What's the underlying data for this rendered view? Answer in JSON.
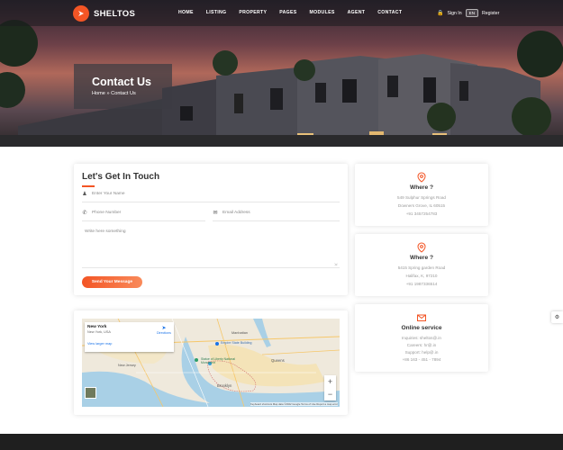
{
  "brand": {
    "name": "SHELTOS",
    "accent": "#f35525"
  },
  "nav": {
    "items": [
      "HOME",
      "LISTING",
      "PROPERTY",
      "PAGES",
      "MODULES",
      "AGENT",
      "CONTACT"
    ],
    "signin": "Sign In",
    "lang": "EN",
    "register": "Register"
  },
  "hero": {
    "title": "Contact Us",
    "crumb_home": "Home",
    "crumb_sep": "»",
    "crumb_current": "Contact Us"
  },
  "form": {
    "title": "Let's Get In Touch",
    "name_placeholder": "Enter Your Name",
    "phone_placeholder": "Phone Number",
    "email_placeholder": "Email Address",
    "message_placeholder": "Write here something",
    "send_label": "Send Your Message"
  },
  "info": [
    {
      "heading": "Where ?",
      "lines": [
        "549 Sulphur Springs Road",
        "Downers Grove, IL 60515",
        "+91 3457254783"
      ],
      "icon": "map-pin-icon"
    },
    {
      "heading": "Where ?",
      "lines": [
        "5415 Spring garden Road",
        "Halifax, K, 97210",
        "+91 1987336514"
      ],
      "icon": "map-pin-icon"
    },
    {
      "heading": "Online service",
      "lines": [
        "Inquiries: sheltos@.in",
        "Careers: hr@.in",
        "Support: help@.in",
        "+86 163 - 451 - 7894"
      ],
      "icon": "mail-icon"
    }
  ],
  "map": {
    "place": "New York",
    "sub": "New York, USA",
    "directions": "Directions",
    "larger": "View larger map",
    "attribution": "Keyboard shortcuts   Map data ©2022 Google   Terms of Use   Report a map error",
    "labels": [
      "New Jersey",
      "Statue of Liberty National Monument",
      "Brooklyn",
      "Queens",
      "Manhattan",
      "Empire State Building"
    ]
  }
}
